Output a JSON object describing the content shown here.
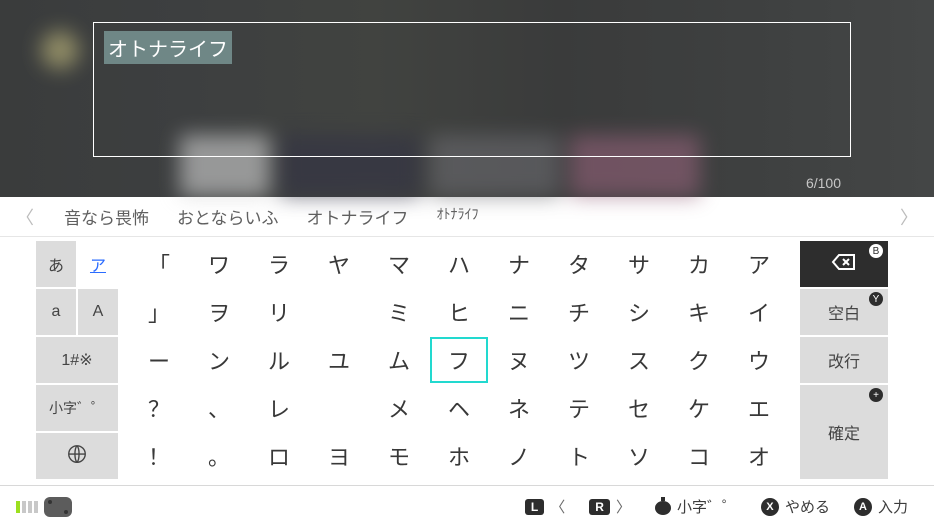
{
  "input": {
    "text": "オトナライフ",
    "count": "6/100"
  },
  "suggestions": {
    "items": [
      "音なら畏怖",
      "おとならいふ",
      "オトナライフ",
      "ｵﾄﾅﾗｲﾌ"
    ]
  },
  "modes": {
    "hiragana": "あ",
    "katakana": "ア",
    "lower": "a",
    "upper": "A",
    "symbols": "1#※",
    "small": "小字゛゜",
    "globe": ""
  },
  "keys": {
    "r0": [
      "「",
      "ワ",
      "ラ",
      "ヤ",
      "マ",
      "ハ",
      "ナ",
      "タ",
      "サ",
      "カ",
      "ア"
    ],
    "r1": [
      "」",
      "ヲ",
      "リ",
      "",
      "ミ",
      "ヒ",
      "ニ",
      "チ",
      "シ",
      "キ",
      "イ"
    ],
    "r2": [
      "ー",
      "ン",
      "ル",
      "ユ",
      "ム",
      "フ",
      "ヌ",
      "ツ",
      "ス",
      "ク",
      "ウ"
    ],
    "r3": [
      "？",
      "、",
      "レ",
      "",
      "メ",
      "ヘ",
      "ネ",
      "テ",
      "セ",
      "ケ",
      "エ"
    ],
    "r4": [
      "！",
      "。",
      "ロ",
      "ヨ",
      "モ",
      "ホ",
      "ノ",
      "ト",
      "ソ",
      "コ",
      "オ"
    ],
    "selected": "フ"
  },
  "actions": {
    "backspace": "⌫",
    "space": "空白",
    "newline": "改行",
    "confirm": "確定",
    "badges": {
      "backspace": "B",
      "space": "Y",
      "confirm": "+"
    }
  },
  "footer": {
    "hints": [
      {
        "type": "pill",
        "glyph": "L",
        "text": "〈"
      },
      {
        "type": "pill",
        "glyph": "R",
        "text": "〉"
      },
      {
        "type": "bomb",
        "glyph": "",
        "text": "小字゛゜"
      },
      {
        "type": "circ",
        "glyph": "X",
        "text": "やめる"
      },
      {
        "type": "circ",
        "glyph": "A",
        "text": "入力"
      }
    ]
  }
}
